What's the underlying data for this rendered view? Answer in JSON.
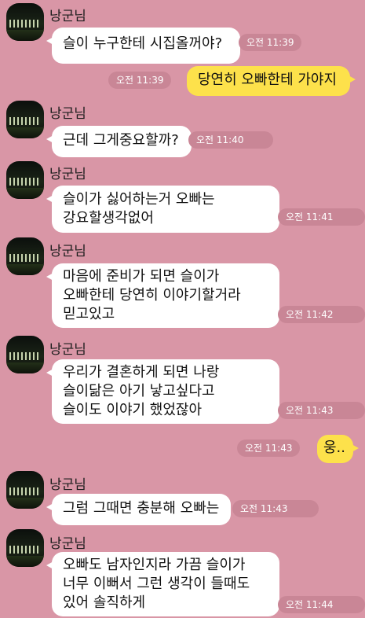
{
  "chat": {
    "messages": [
      {
        "sender": "낭군님",
        "text": "슬이 누구한테 시집올꺼야?",
        "time": "오전 11:39"
      },
      {
        "sender": "",
        "text": "당연히 오빠한테 가야지",
        "time": "오전 11:39"
      },
      {
        "sender": "낭군님",
        "text": "근데 그게중요할까?",
        "time": "오전 11:40"
      },
      {
        "sender": "낭군님",
        "text": "슬이가 싫어하는거 오빠는\n강요할생각없어",
        "time": "오전 11:41"
      },
      {
        "sender": "낭군님",
        "text": "마음에 준비가 되면 슬이가\n오빠한테 당연히 이야기할거라\n믿고있고",
        "time": "오전 11:42"
      },
      {
        "sender": "낭군님",
        "text": "우리가 결혼하게 되면 나랑\n슬이닮은 아기 낳고싶다고\n슬이도 이야기 했었잖아",
        "time": "오전 11:43"
      },
      {
        "sender": "",
        "text": "웅..",
        "time": "오전 11:43"
      },
      {
        "sender": "낭군님",
        "text": "그럼 그때면 충분해 오빠는",
        "time": "오전 11:43"
      },
      {
        "sender": "낭군님",
        "text": "오빠도 남자인지라 가끔 슬이가\n너무 이뻐서 그런 생각이 들때도\n있어 솔직하게",
        "time": "오전 11:44"
      }
    ]
  }
}
